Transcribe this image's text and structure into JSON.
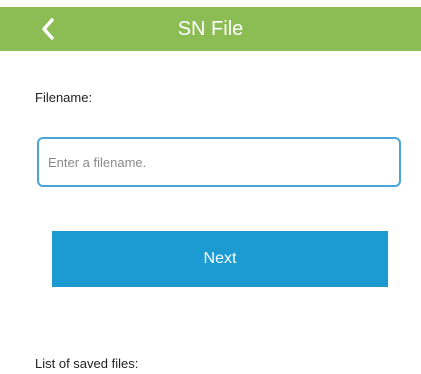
{
  "header": {
    "title": "SN File",
    "back_icon": "chevron-left-icon",
    "background_color": "#8cbc54"
  },
  "form": {
    "filename_label": "Filename:",
    "filename_placeholder": "Enter a filename.",
    "filename_value": "",
    "next_label": "Next",
    "accent_color": "#1b9bd2"
  },
  "saved_files": {
    "label": "List of saved files:",
    "items": []
  }
}
